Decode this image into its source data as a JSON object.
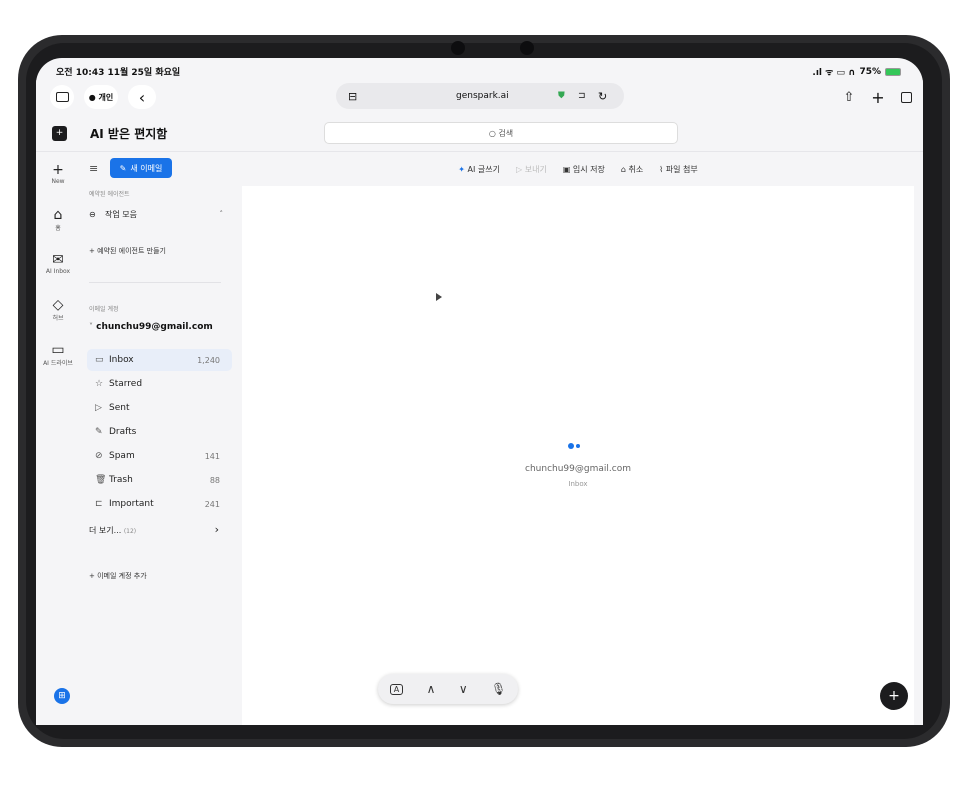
{
  "status": {
    "time": "오전 10:43  11월 25일 화요일",
    "battery": "75%",
    "signal": ".ıl ᯤ ▭ ∩"
  },
  "browser": {
    "profile": "개인",
    "url": "genspark.ai"
  },
  "app": {
    "title": "AI 받은 편지함",
    "search_placeholder": "검색"
  },
  "rail": [
    {
      "label": "New",
      "icon": "plus-icon",
      "glyph": "+"
    },
    {
      "label": "홈",
      "icon": "home-icon",
      "glyph": "⌂"
    },
    {
      "label": "AI Inbox",
      "icon": "inbox-icon",
      "glyph": "✉"
    },
    {
      "label": "허브",
      "icon": "hub-icon",
      "glyph": "◇"
    },
    {
      "label": "AI 드라이브",
      "icon": "folder-icon",
      "glyph": "▭"
    }
  ],
  "sidebar": {
    "new_mail": "새 이메일",
    "reserved_agent": "예약된 에이전트",
    "task_collection": "작업 모음",
    "create_agent": "예약된 에이전트 만들기",
    "email_account_label": "이메일 계정",
    "account": "chunchu99@gmail.com",
    "folders": [
      {
        "name": "Inbox",
        "count": "1,240",
        "icon": "inbox-tray-icon",
        "glyph": "▭"
      },
      {
        "name": "Starred",
        "count": "",
        "icon": "star-icon",
        "glyph": "☆"
      },
      {
        "name": "Sent",
        "count": "",
        "icon": "send-icon",
        "glyph": "▷"
      },
      {
        "name": "Drafts",
        "count": "",
        "icon": "draft-icon",
        "glyph": "✎"
      },
      {
        "name": "Spam",
        "count": "141",
        "icon": "spam-icon",
        "glyph": "⊘"
      },
      {
        "name": "Trash",
        "count": "88",
        "icon": "trash-icon",
        "glyph": "🗑"
      },
      {
        "name": "Important",
        "count": "241",
        "icon": "important-icon",
        "glyph": "⊏"
      }
    ],
    "more": "더 보기...",
    "more_count": "(12)",
    "add_account": "이메일 계정 추가"
  },
  "compose": {
    "ai_write": "AI 글쓰기",
    "send": "보내기",
    "save_draft": "임시 저장",
    "cancel": "취소",
    "attach": "파일 첨부"
  },
  "content": {
    "account": "chunchu99@gmail.com",
    "folder": "Inbox"
  },
  "keyboard_bar": {
    "key": "A"
  },
  "colors": {
    "accent": "#1a73e8",
    "selected_bg": "#e8eef9"
  }
}
